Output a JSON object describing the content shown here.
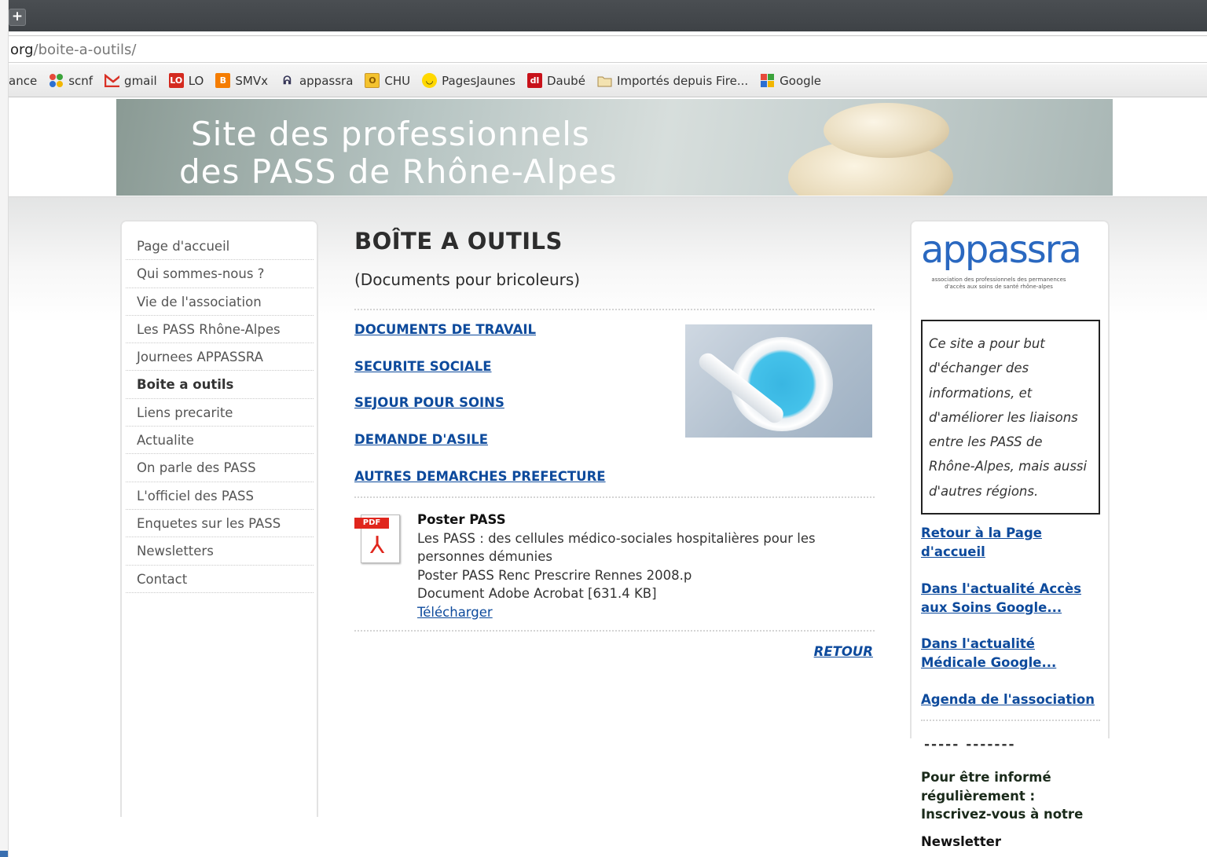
{
  "browser": {
    "url_host": "org",
    "url_path": "/boite-a-outils/",
    "bookmarks": [
      {
        "label": "ance",
        "icon": "none"
      },
      {
        "label": "scnf",
        "icon": "dots-icon"
      },
      {
        "label": "gmail",
        "icon": "gmail-icon"
      },
      {
        "label": "LO",
        "icon": "lo-icon"
      },
      {
        "label": "SMVx",
        "icon": "blogger-icon"
      },
      {
        "label": "appassra",
        "icon": "appassra-icon"
      },
      {
        "label": "CHU",
        "icon": "chu-icon"
      },
      {
        "label": "PagesJaunes",
        "icon": "smiley-icon"
      },
      {
        "label": "Daubé",
        "icon": "dl-icon"
      },
      {
        "label": "Importés depuis Fire...",
        "icon": "folder-icon"
      },
      {
        "label": "Google",
        "icon": "google-icon"
      }
    ]
  },
  "banner": {
    "line1": "Site des professionnels",
    "line2": "des PASS de Rhône-Alpes"
  },
  "nav": {
    "items": [
      "Page d'accueil",
      "Qui sommes-nous ?",
      "Vie de l'association",
      "Les PASS Rhône-Alpes",
      "Journees APPASSRA",
      "Boite a outils",
      "Liens precarite",
      "Actualite",
      "On parle des PASS",
      "L'officiel des PASS",
      "Enquetes sur les PASS",
      "Newsletters",
      "Contact"
    ],
    "active_index": 5
  },
  "main": {
    "title": "BOÎTE A OUTILS",
    "subtitle": "(Documents pour bricoleurs)",
    "links": [
      "DOCUMENTS DE TRAVAIL",
      "SECURITE SOCIALE",
      "SEJOUR POUR SOINS",
      "DEMANDE D'ASILE",
      "AUTRES DEMARCHES PREFECTURE"
    ],
    "document": {
      "icon_tag": "PDF",
      "title": "Poster PASS",
      "description_line1": "Les PASS : des cellules médico-sociales hospitalières pour les",
      "description_line2": "personnes démunies",
      "filename": "Poster PASS Renc Prescrire Rennes 2008.p",
      "filetype": "Document Adobe Acrobat [631.4 KB]",
      "download": "Télécharger"
    },
    "retour": "RETOUR"
  },
  "sidebar": {
    "logo": "appassra",
    "logo_sub": "association des professionnels des permanences d'accès aux soins de santé rhône-alpes",
    "info": "Ce site a pour but d'échanger des informations, et d'améliorer les liaisons entre les PASS de Rhône-Alpes, mais aussi d'autres régions.",
    "links": [
      {
        "line1": "Retour à la Page",
        "line2": "d'accueil "
      },
      {
        "line1": "Dans l'actualité Accès",
        "line2": "aux Soins Google..."
      },
      {
        "line1": "Dans l'actualité",
        "line2": "Médicale Google..."
      },
      {
        "line1": "Agenda de l'association",
        "line2": ""
      }
    ],
    "dashes": "----- -------",
    "news_line1": "Pour être informé",
    "news_line2": "régulièrement :",
    "news_line3": "Inscrivez-vous à notre",
    "newsletter": "Newsletter"
  }
}
